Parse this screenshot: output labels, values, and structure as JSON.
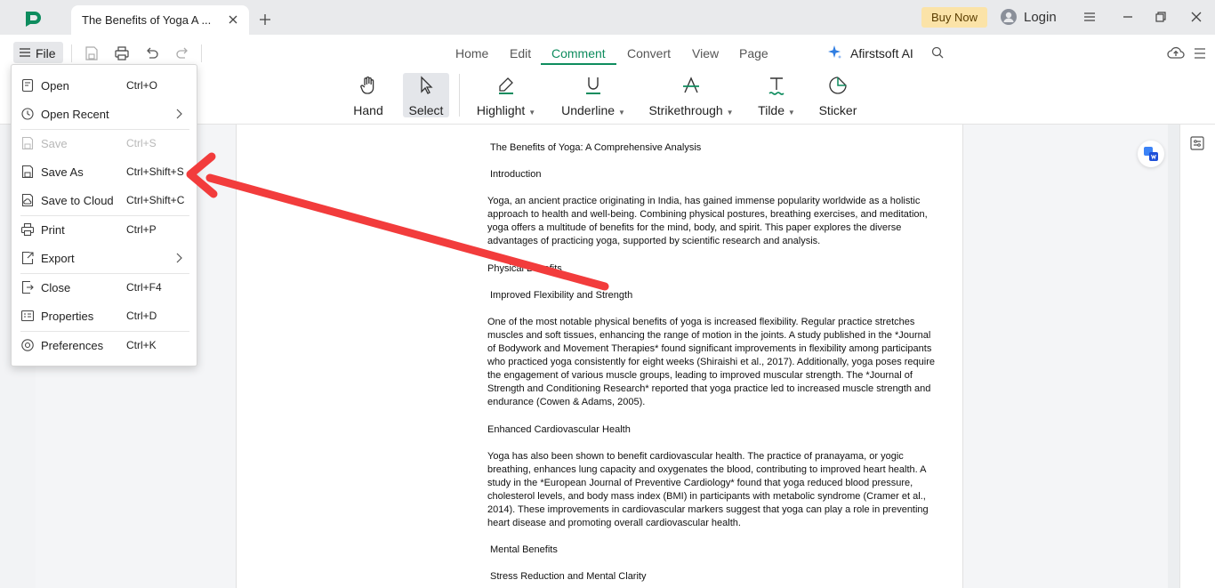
{
  "window": {
    "tab_title": "The Benefits of Yoga A ...",
    "buy_now": "Buy Now",
    "login": "Login",
    "brand_color": "#0e8c5e"
  },
  "toolbar": {
    "file_label": "File",
    "menu_tabs": [
      "Home",
      "Edit",
      "Comment",
      "Convert",
      "View",
      "Page"
    ],
    "active_tab": "Comment",
    "ai_label": "Afirstsoft AI",
    "tools": [
      {
        "label": "Hand",
        "icon": "hand-icon"
      },
      {
        "label": "Select",
        "icon": "cursor-icon",
        "selected": true
      },
      {
        "label": "Highlight",
        "icon": "highlighter-icon",
        "dropdown": true
      },
      {
        "label": "Underline",
        "icon": "underline-icon",
        "dropdown": true
      },
      {
        "label": "Strikethrough",
        "icon": "strikethrough-icon",
        "dropdown": true
      },
      {
        "label": "Tilde",
        "icon": "tilde-icon",
        "dropdown": true
      },
      {
        "label": "Sticker",
        "icon": "sticker-icon"
      }
    ]
  },
  "file_menu": {
    "items": [
      {
        "label": "Open",
        "shortcut": "Ctrl+O",
        "icon": "open-file-icon"
      },
      {
        "label": "Open Recent",
        "shortcut": "",
        "icon": "clock-icon",
        "submenu": true
      },
      {
        "label": "Save",
        "shortcut": "Ctrl+S",
        "icon": "save-icon",
        "disabled": true
      },
      {
        "label": "Save As",
        "shortcut": "Ctrl+Shift+S",
        "icon": "save-as-icon"
      },
      {
        "label": "Save to Cloud",
        "shortcut": "Ctrl+Shift+C",
        "icon": "save-cloud-icon"
      },
      {
        "label": "Print",
        "shortcut": "Ctrl+P",
        "icon": "print-icon"
      },
      {
        "label": "Export",
        "shortcut": "",
        "icon": "export-icon",
        "submenu": true
      },
      {
        "label": "Close",
        "shortcut": "Ctrl+F4",
        "icon": "close-file-icon"
      },
      {
        "label": "Properties",
        "shortcut": "Ctrl+D",
        "icon": "properties-icon"
      },
      {
        "label": "Preferences",
        "shortcut": "Ctrl+K",
        "icon": "preferences-icon"
      }
    ]
  },
  "document": {
    "title": "The Benefits of Yoga: A Comprehensive Analysis",
    "intro_heading": "Introduction",
    "intro_lines": [
      "Yoga, an ancient practice originating in India, has gained immense popularity worldwide as a holistic",
      "approach to health and well-being. Combining physical postures, breathing exercises, and meditation,",
      "yoga offers a multitude of benefits for the mind, body, and spirit. This paper explores the diverse",
      "advantages of practicing yoga, supported by scientific research and analysis."
    ],
    "physical_heading": "Physical Benefits",
    "flex_heading": "Improved Flexibility and Strength",
    "flex_lines": [
      "One of the most notable physical benefits of yoga is increased flexibility. Regular practice stretches",
      "muscles and soft tissues, enhancing the range of motion in the joints. A study published in the *Journal",
      "of Bodywork and Movement Therapies* found significant improvements in flexibility among participants",
      "who practiced yoga consistently for eight weeks (Shiraishi et al., 2017). Additionally, yoga poses require",
      "the engagement of various muscle groups, leading to improved muscular strength. The *Journal of",
      "Strength and Conditioning Research* reported that yoga practice led to increased muscle strength and",
      "endurance (Cowen & Adams, 2005)."
    ],
    "cardio_heading": "Enhanced Cardiovascular Health",
    "cardio_lines": [
      "Yoga has also been shown to benefit cardiovascular health. The practice of pranayama, or yogic",
      "breathing, enhances lung capacity and oxygenates the blood, contributing to improved heart health. A",
      "study in the *European Journal of Preventive Cardiology* found that yoga reduced blood pressure,",
      "cholesterol levels, and body mass index (BMI) in participants with metabolic syndrome (Cramer et al.,",
      "2014). These improvements in cardiovascular markers suggest that yoga can play a role in preventing",
      "heart disease and promoting overall cardiovascular health."
    ],
    "mental_heading": "Mental Benefits",
    "stress_heading": "Stress Reduction and Mental Clarity"
  },
  "annotation": {
    "arrow_color": "#f23c3c"
  }
}
